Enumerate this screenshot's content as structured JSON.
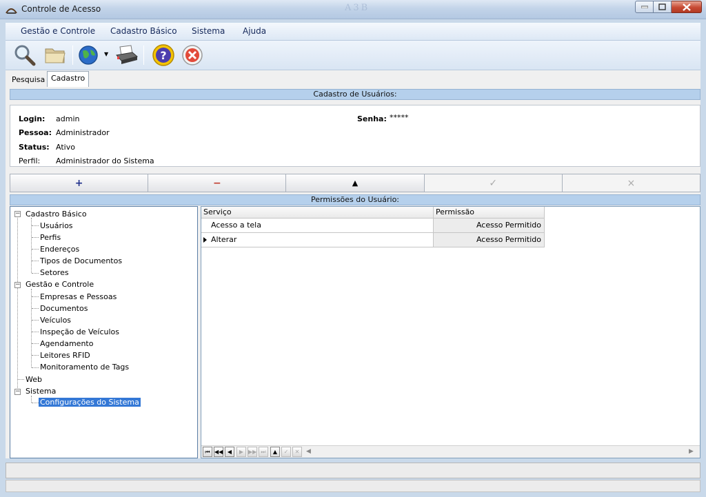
{
  "window": {
    "title": "Controle de Acesso",
    "title_decoration": "A3B"
  },
  "menu": [
    "Gestão e Controle",
    "Cadastro Básico",
    "Sistema",
    "Ajuda"
  ],
  "toolbar": [
    "search-icon",
    "folder-icon",
    "globe-icon",
    "printer-icon",
    "help-icon",
    "exit-icon"
  ],
  "tabs": {
    "pesquisa": "Pesquisa",
    "cadastro": "Cadastro"
  },
  "header_band": "Cadastro de Usuários:",
  "user": {
    "login_label": "Login:",
    "login": "admin",
    "senha_label": "Senha:",
    "senha": "*****",
    "pessoa_label": "Pessoa:",
    "pessoa": "Administrador",
    "status_label": "Status:",
    "status": "Ativo",
    "perfil_label": "Perfil:",
    "perfil": "Administrador do Sistema"
  },
  "actions": [
    "+",
    "−",
    "▲",
    "✓",
    "×"
  ],
  "permissions_band": "Permissões do Usuário:",
  "tree": {
    "g1": "Cadastro Básico",
    "g1_items": [
      "Usuários",
      "Perfis",
      "Endereços",
      "Tipos de Documentos",
      "Setores"
    ],
    "g2": "Gestão e Controle",
    "g2_items": [
      "Empresas e Pessoas",
      "Documentos",
      "Veículos",
      "Inspeção de Veículos",
      "Agendamento",
      "Leitores RFID",
      "Monitoramento de Tags"
    ],
    "web": "Web",
    "g3": "Sistema",
    "g3_items": [
      "Configurações do Sistema"
    ]
  },
  "grid": {
    "columns": [
      "Serviço",
      "Permissão"
    ],
    "rows": [
      {
        "servico": "Acesso a tela",
        "permissao": "Acesso Permitido"
      },
      {
        "servico": "Alterar",
        "permissao": "Acesso Permitido"
      }
    ]
  },
  "colors": {
    "band": "#b5d0ec",
    "selection": "#3478d6",
    "menu_text": "#15285a"
  }
}
